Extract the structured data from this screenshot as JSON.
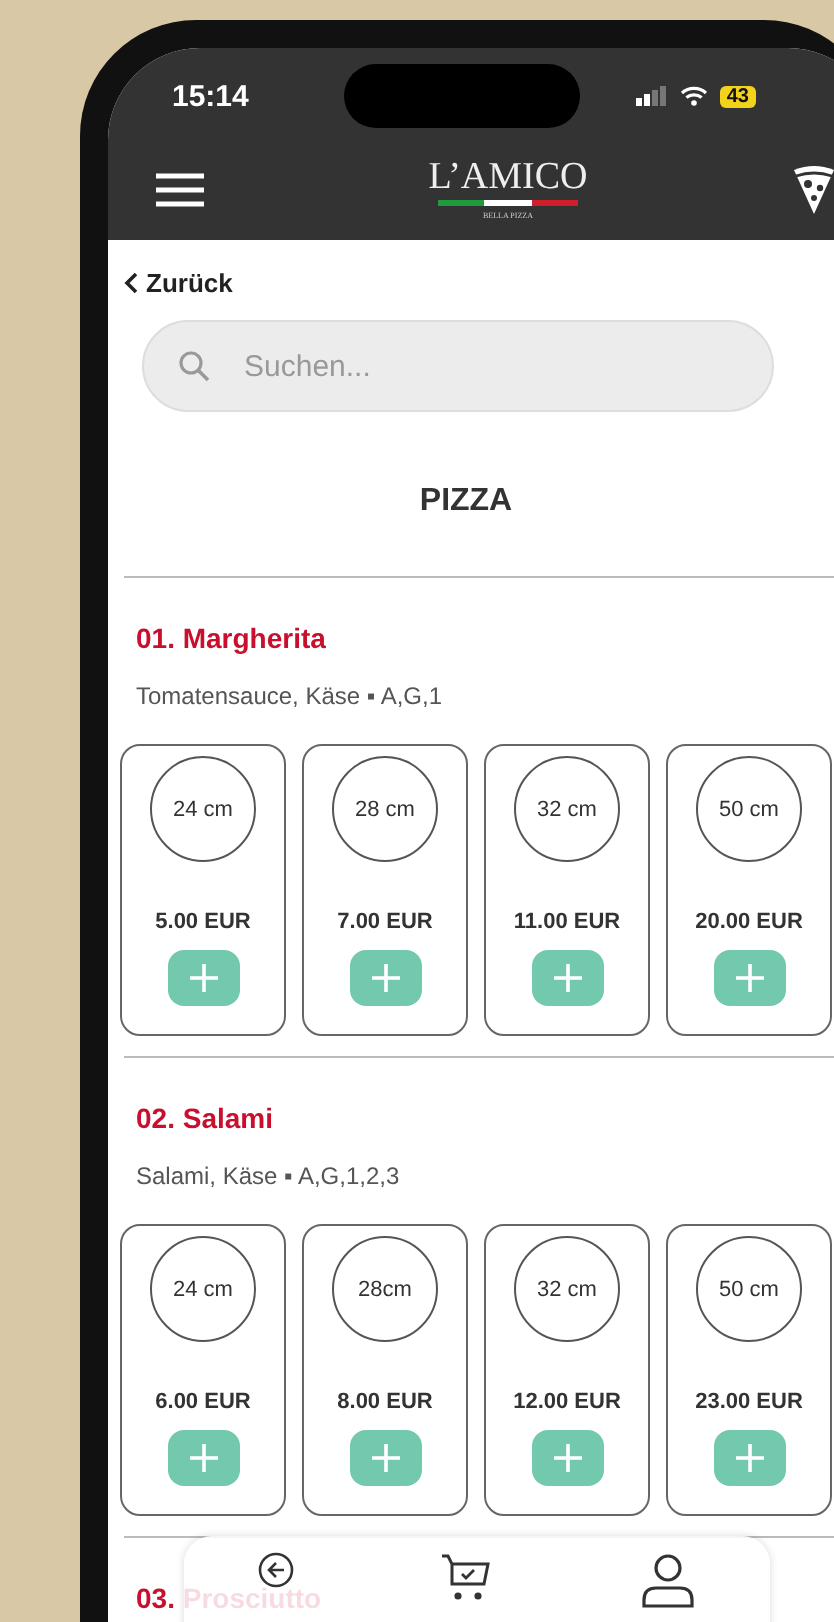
{
  "status_bar": {
    "time": "15:14",
    "battery": "43"
  },
  "header": {
    "logo_title": "L’AMICO",
    "logo_subtitle": "BELLA PIZZA"
  },
  "back_link": "Zurück",
  "search": {
    "placeholder": "Suchen..."
  },
  "category": "PIZZA",
  "items": [
    {
      "title": "01. Margherita",
      "description": "Tomatensauce, Käse ▪ A,G,1",
      "sizes": [
        {
          "size": "24 cm",
          "price": "5.00 EUR"
        },
        {
          "size": "28 cm",
          "price": "7.00 EUR"
        },
        {
          "size": "32 cm",
          "price": "11.00 EUR"
        },
        {
          "size": "50 cm",
          "price": "20.00 EUR"
        }
      ]
    },
    {
      "title": "02. Salami",
      "description": "Salami, Käse ▪ A,G,1,2,3",
      "sizes": [
        {
          "size": "24 cm",
          "price": "6.00 EUR"
        },
        {
          "size": "28cm",
          "price": "8.00 EUR"
        },
        {
          "size": "32 cm",
          "price": "12.00 EUR"
        },
        {
          "size": "50 cm",
          "price": "23.00 EUR"
        }
      ]
    },
    {
      "title": "03. Prosciutto"
    }
  ]
}
